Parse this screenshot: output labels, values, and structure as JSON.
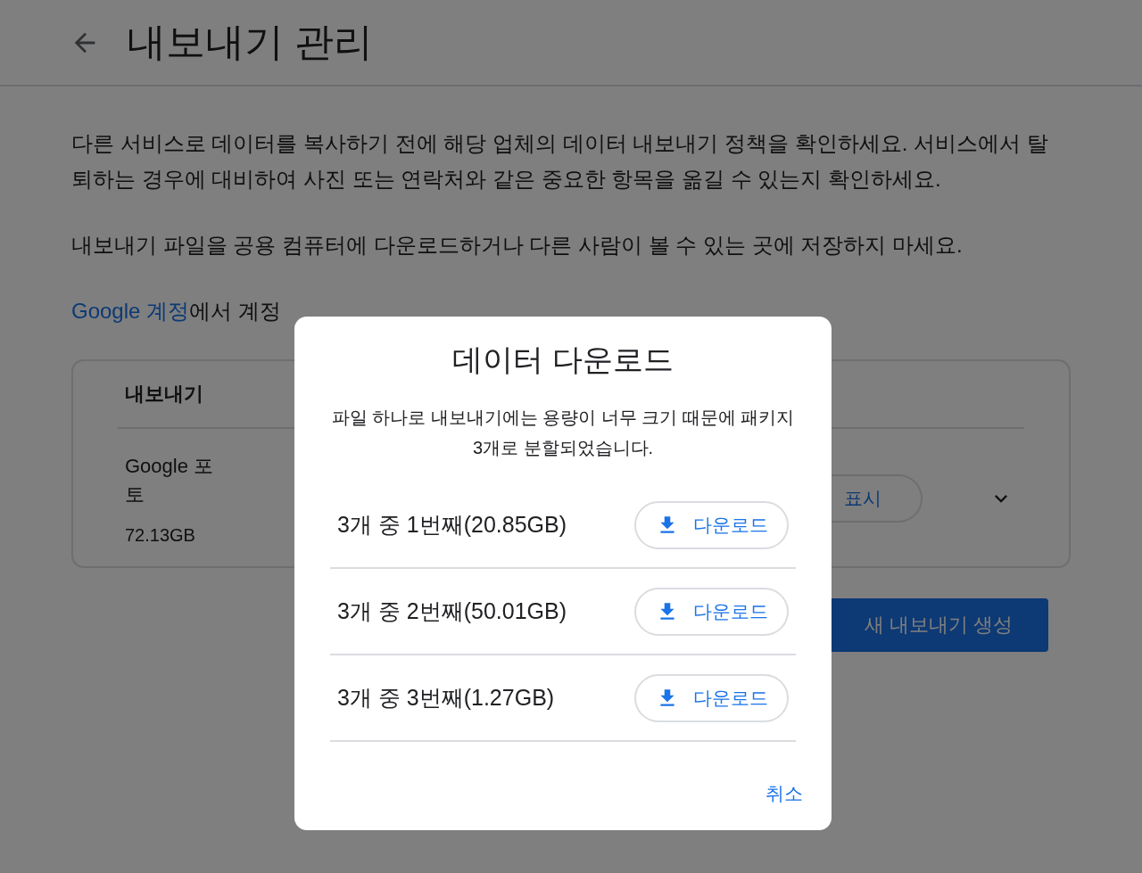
{
  "header": {
    "title": "내보내기 관리"
  },
  "paragraphs": [
    "다른 서비스로 데이터를 복사하기 전에 해당 업체의 데이터 내보내기 정책을 확인하세요. 서비스에서 탈퇴하는 경우에 대비하여 사진 또는 연락처와 같은 중요한 항목을 옮길 수 있는지 확인하세요.",
    "내보내기 파일을 공용 컴퓨터에 다운로드하거나 다른 사람이 볼 수 있는 곳에 저장하지 마세요."
  ],
  "link_paragraph": {
    "link": "Google 계정",
    "text": "에서 계정"
  },
  "exports_card": {
    "heading": "내보내기",
    "rows": [
      {
        "name": "Google 포토",
        "size": "72.13GB",
        "button": "표시"
      }
    ]
  },
  "create_button": "새 내보내기 생성",
  "dialog": {
    "title": "데이터 다운로드",
    "description": "파일 하나로 내보내기에는 용량이 너무 크기 때문에 패키지 3개로 분할되었습니다.",
    "parts": [
      {
        "label": "3개 중 1번째(20.85GB)",
        "button": "다운로드"
      },
      {
        "label": "3개 중 2번째(50.01GB)",
        "button": "다운로드"
      },
      {
        "label": "3개 중 3번째(1.27GB)",
        "button": "다운로드"
      }
    ],
    "cancel": "취소"
  }
}
